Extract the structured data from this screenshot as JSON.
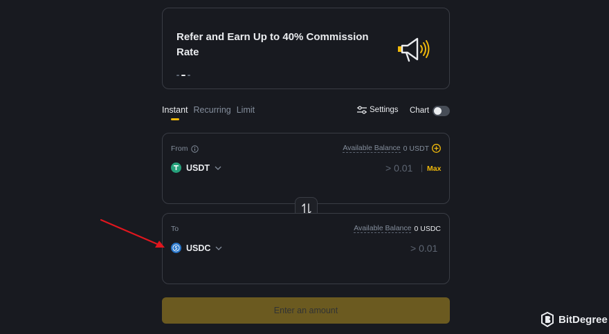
{
  "banner": {
    "title": "Refer and Earn Up to 40% Commission Rate"
  },
  "tabs": [
    {
      "label": "Instant"
    },
    {
      "label": "Recurring"
    },
    {
      "label": "Limit"
    }
  ],
  "toolbar": {
    "settings_label": "Settings",
    "chart_label": "Chart",
    "chart_enabled": false
  },
  "from": {
    "label": "From",
    "balance_label": "Available Balance",
    "balance_value": "0 USDT",
    "coin": "USDT",
    "amount_placeholder": "> 0.01",
    "max_label": "Max"
  },
  "to": {
    "label": "To",
    "balance_label": "Available Balance",
    "balance_value": "0 USDC",
    "coin": "USDC",
    "amount_placeholder": "> 0.01"
  },
  "cta": {
    "label": "Enter an amount"
  },
  "watermark": {
    "brand": "BitDegree"
  },
  "colors": {
    "accent": "#f0b90b",
    "bg": "#181a20",
    "border": "#3a3d45",
    "arrow": "#e0161e"
  },
  "icons": [
    "megaphone-icon",
    "settings-sliders-icon",
    "info-icon",
    "add-circle-icon",
    "usdt-coin-icon",
    "usdc-coin-icon",
    "chevron-down-icon",
    "swap-arrows-icon"
  ]
}
